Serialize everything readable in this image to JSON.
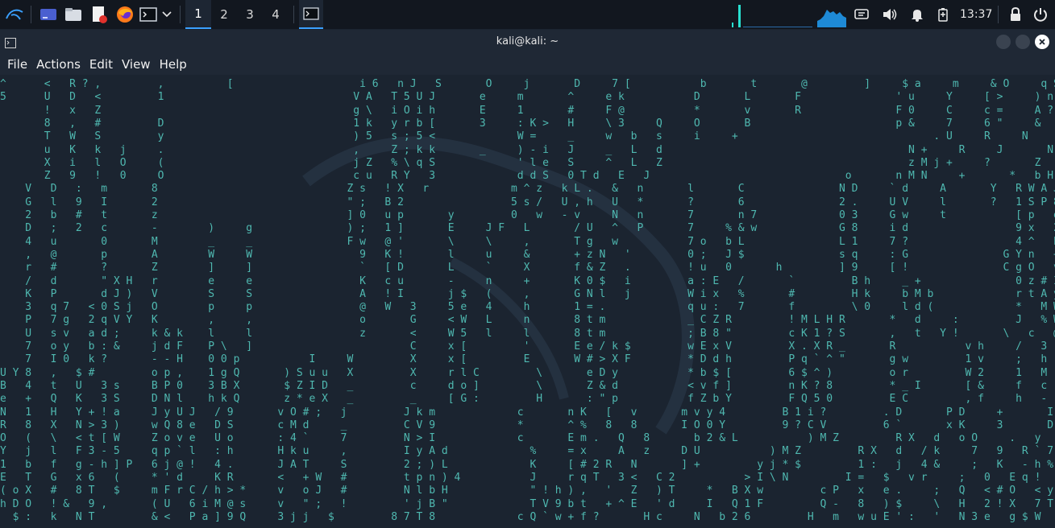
{
  "panel": {
    "workspaces": [
      "1",
      "2",
      "3",
      "4"
    ],
    "active_workspace": "1",
    "clock": "13:37",
    "icons": [
      "kali-menu-icon",
      "show-desktop-icon",
      "file-manager-icon",
      "text-editor-icon",
      "firefox-icon",
      "terminal-icon",
      "chevron-down-icon",
      "terminal-task-icon",
      "network-monitor-icon",
      "cpu-graph-icon",
      "notifications-icon",
      "volume-icon",
      "bell-icon",
      "battery-icon",
      "lock-icon",
      "power-icon"
    ]
  },
  "window": {
    "title": "kali@kali: ~"
  },
  "menu": {
    "items": [
      "File",
      "Actions",
      "Edit",
      "View",
      "Help"
    ]
  },
  "colors": {
    "matrix": "#4fb8b0",
    "bright": "#ffffff",
    "background": "#1b2430",
    "panel": "#12171f",
    "accent": "#3aa0ff"
  },
  "matrix_rows": [
    "^      <   R ? ,         ,          [                    i 6   n J   S       O     j       D     7 [           b       t       @         ]     $ a     m     & O     q S 1 v b #           d 0     z         k ^",
    "5      U   D   <         1                              V A   T 5 U J       e     m       ^     e k           D       L       F               ' u     Y     [ >     ) n < 7 x           ! P     $         p F",
    "       !   x   Z                                        g \\   i O i h       E     1       #     F @           *       v       R               F 0     C     c =     A ? : B ? ,         + v     L         B ?",
    "       8   ,   #         D                              1 k   y r b [       3     : K >   H     \\ 3     Q     O       B                       p &     7     6 \"     &   [ w @ M A       [ ]     w         ] # #",
    "       T   W   S         y                              ) 5   s ; 5 <             W =     _     w   b   s     i     +                               . U     R     N       J   T V i w q       q N ? \\       Z 5 F",
    "       u   K   k   j     .                              ,     Z ; k k       _     ) - i   J     _   L   d                                       N +     R     J       N   9 - ` y K       - k k I       R m q",
    "       X   i   l   O     (                              j Z   % \\ q S             ' l e   S     ^   L   Z                                       z M j +     ?       Z   % w : c 2       8 H s &       < j *",
    "       Z   9   !   0     O                              c u   R Y   3             d d S   0 T d   E   J                               o       n M N     +       *   b H n 1 2       I @ o )       i 3 1",
    "    V   D   :   m       8                              Z s   ! X   r             m ^ z   k L .   &   n       l       C               N D     ` d     A       Y   R W A J <       S t = /       [ G l",
    "    G   l   9   I       2                              \" ;   B 2                 5 s /   U , h   U   *       ?       6               2 .     U V     l       ?   1 S P 8         H @ * 2       % R S",
    "    2   b   #   t       z                              ] 0   u p       y         0   w   - v     N   n       7       n 7             0 3     G w     t           [ p   e         ! u Y z       U ( B",
    "    D   ;   2   c       -        )     g               ) ;   1 ]       E     J F   L       / U   ^   P       7     % & w             G 8     i d                 9 x   2         d I _         i m r i",
    "    4   u       0       M        _     _               F w   @ '       \\     \\     ,       T g   w           7 o   b L               L 1     7 ?                 4 ^   E         \" n ^         % ! . *",
    "    ,   @       p       A        W     W                 9   K !       l     u     &       + z N   '         0 ;   J $               s q     : G               G Y n   +         z % G         5 8 F",
    "    r   #       ?       Z        ]     ]                 `   [ D       L     `     X       f & Z   .         ! u   0       h         ] 9     [ !               C g O   v         # > f         2 G *",
    "    /   d       \" X H   r        e     e                 K   c u       -     n     +       K 0 $   i         a : E   /       `         B h     _ +               0 z # I         ' ) /         2 : 9 $",
    "    K   P       d J )   V        S     S                 A   ! I       j $   (     ,       G N l   j         W i x   %       #         H k     b M b             r t A y         r V O         0 K d n",
    "    3   q 7   < 0 S j   O        p     p                 @   W   3     5 e   4     h       1 = .             q u :   7       f         \\ 0     l d (             *   M W         t / W         w : 2 m",
    "    P   7 g   2 q V Y   K        ,     ,                 o       G     < W   L     n       8 t m             _ C Z R         ! M L H R       *   d     :         J   % W   H   V   Q z P         q ] u",
    "    U   s v   a d ;     k & k    l     l                 z       <     W 5   l     l       8 t m             ; B 8 \"         c K 1 ? S       ,   t   Y !       \\   c   @   *   h + x         ' r j",
    "    7   o y   b : &     j d F    P \\   ]                         C     x [         '       E e / k $         w E x V         X . X R _       R           v h     /   3   !   S   +         ; U O",
    "    7   I 0   k ?       - - H    0 0 p           I     W         X     x [         E       W # > X F         * D d h         P q ` ^ \"       g w         1 v     ;   h   7   6   N   C         M < w",
    "U Y 8   ,   $ #         o p ,    1 g Q       ) S u u   X         X     r l C         \\       e D y           * b $ [         6 $ ^ )         o r         W 2     1   M   p   a 0   r         ` s -",
    "B   4   t   U   3 s     B P 0    3 B X       $ Z I D   _         c     d o ]         \\       Z & d           < v f ]         n K ? 8         * _ I       [ &     f   c   _ Y ]   C         R y C",
    "e   +   Q   K   3 S     D N l    h k Q       z * e X   _         _     [ G :         H       : \" p           f Z b Y         F Q 5 0         E C         , f     h   -   i @ (   \"         ' M l",
    "N   1   H   Y + ! a     J y U J   / 9       v O # ;   j         J k m             c       n K   [   v       m v y 4         B 1 i ?         . D       P D     +       I p m %   a         @ $ V",
    "R   8   X   N > 3 )     w Q 8 e   D S       c M d     _         C V 9             *       ^ %   8   8       I O 0 Y         9 ? C V         6 `       x K     3       D o F     v         Q 6 T",
    "O   (   \\   < t [ W     Z o v e   U o       : 4 `     7         N > I             c       E m .   Q   8       b 2 & L           ) M Z         R X   d   o O     .   y   Y O H     2         b ; C",
    "Y   j   l   F 3 - 5     q p ` l   : h       H k u     ,         I y A d             %     = x     A   z     D U           ) M Z         R X   d   / k     7   9   R ` 7     _         k , c   B",
    "1   b   f   g - h ] P   6 j @ !   4 .       J A T     S         2 ; ) L             K     [ # 2 R   N       ] +         y j * $         1 :   j   4 &     ;   K   - h %     p",
    "E   T   G   x 6   (     * ' d     K R       <   + W   #         t p n ) 4           J     r q T   3 <   C 2           > I \\ N         I =   $   v r     ;   0   E q !     c",
    "( o X   #   8 T   $     m F r C / h > *     v   o J   #         N l b H             \" ! h ) ,   '   Z   ) T     *   B X w         c P   x   e .     ;   Q   < # O   < y",
    "h D O   ! &   9 ,       ( U   6 i M @ s     v   \" ;   !         ' j B \"             T V 9 b t   + ^ E   ' d     I   Q 1 F         Q -   8   ) $     \\   H   2 ! X   7 T     ;",
    "  $ :   k   N T         & <   P a ] 9 Q     3 j j   $         8 7 T 8             c Q ` w + f ?       H c     N   b 2 6         H   m   w u E ' :   '   N 3 e   g $ W   y"
  ]
}
